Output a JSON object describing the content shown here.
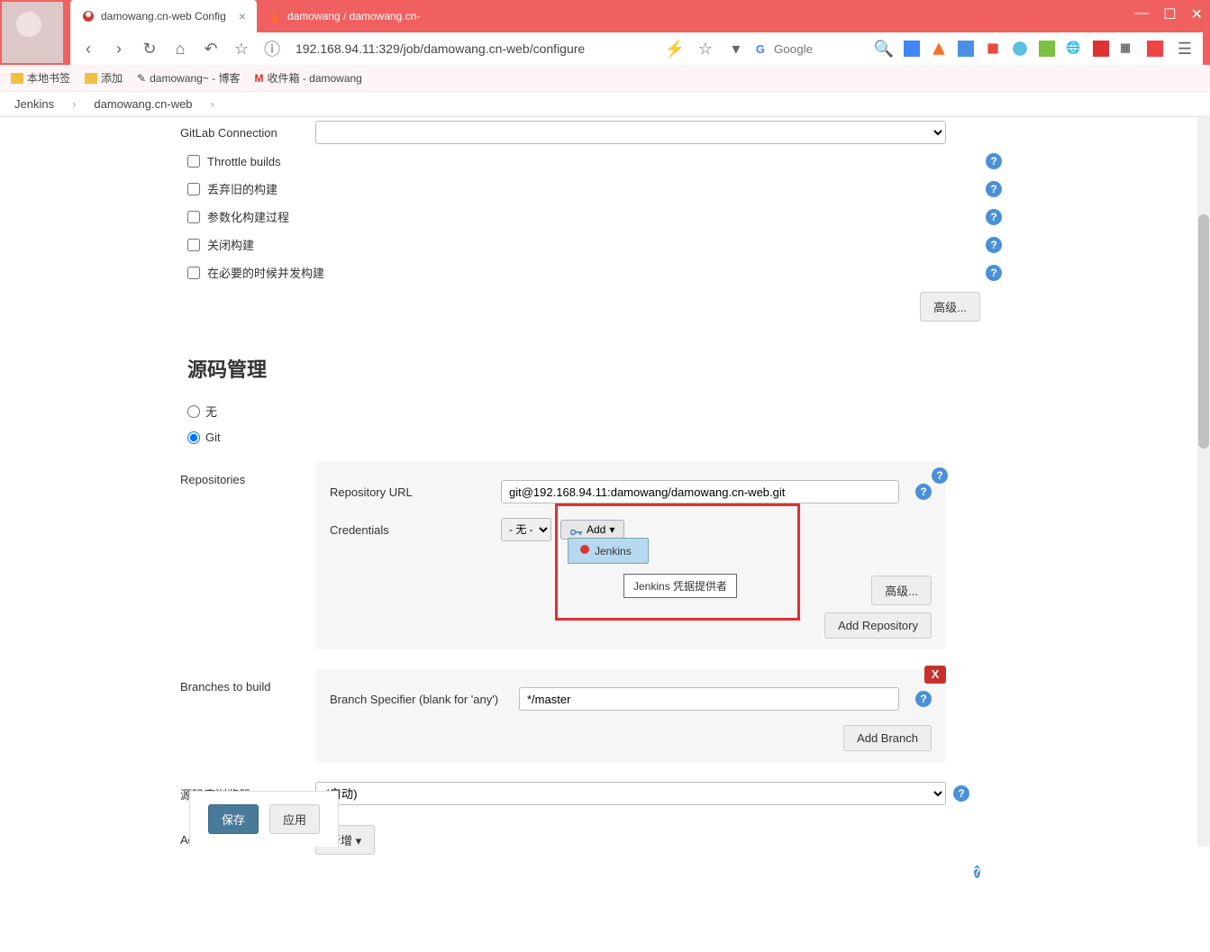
{
  "browser": {
    "tabs": [
      {
        "label": "damowang.cn-web Config",
        "active": true
      },
      {
        "label": "damowang / damowang.cn-",
        "active": false
      }
    ],
    "url": "192.168.94.11:329/job/damowang.cn-web/configure",
    "search_placeholder": "Google",
    "bookmarks": [
      "本地书签",
      "添加",
      "damowang~ - 博客",
      "收件箱 - damowang"
    ]
  },
  "breadcrumb": [
    "Jenkins",
    "damowang.cn-web"
  ],
  "config": {
    "gitlab_connection_label": "GitLab Connection",
    "checkboxes": [
      "Throttle builds",
      "丢弃旧的构建",
      "参数化构建过程",
      "关闭构建",
      "在必要的时候并发构建"
    ],
    "advanced_btn": "高级..."
  },
  "scm": {
    "section_title": "源码管理",
    "none_label": "无",
    "git_label": "Git",
    "repositories_label": "Repositories",
    "repo_url_label": "Repository URL",
    "repo_url_value": "git@192.168.94.11:damowang/damowang.cn-web.git",
    "credentials_label": "Credentials",
    "credentials_value": "- 无 -",
    "add_label": "Add",
    "jenkins_item": "Jenkins",
    "jenkins_tooltip": "Jenkins 凭据提供者",
    "advanced_btn": "高级...",
    "add_repo_btn": "Add Repository",
    "branches_label": "Branches to build",
    "branch_spec_label": "Branch Specifier (blank for 'any')",
    "branch_spec_value": "*/master",
    "add_branch_btn": "Add Branch",
    "delete_x": "X",
    "repo_browser_label": "源码库浏览器",
    "repo_browser_value": "(自动)",
    "additional_label": "Additional Behaviours",
    "additional_btn": "新增"
  },
  "footer": {
    "save": "保存",
    "apply": "应用"
  }
}
